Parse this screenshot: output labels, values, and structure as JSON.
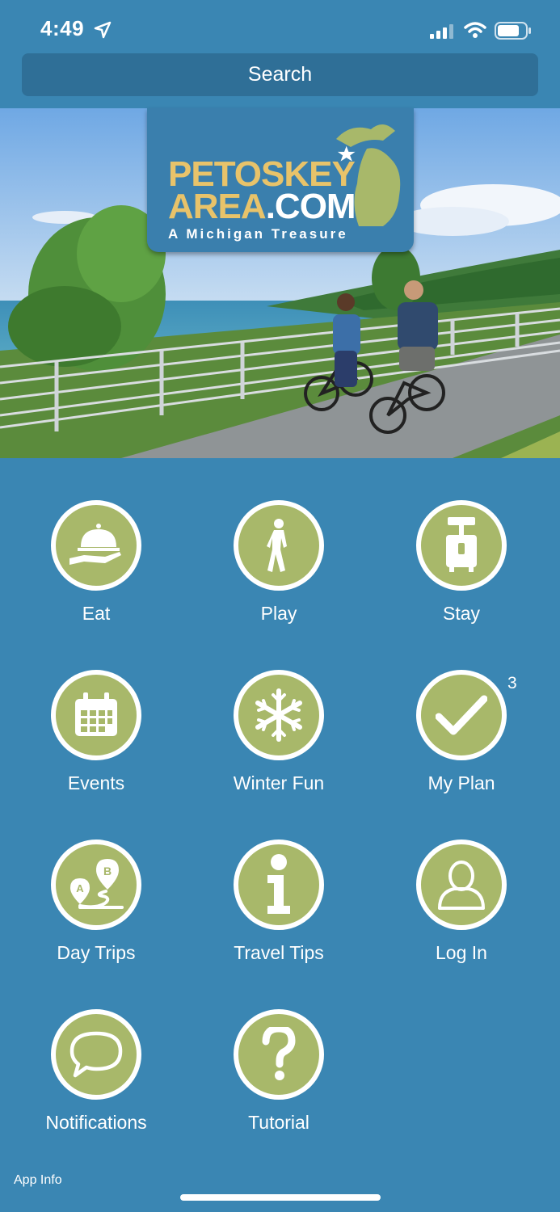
{
  "status": {
    "time": "4:49"
  },
  "search": {
    "label": "Search"
  },
  "logo": {
    "line1": "PETOSKEY",
    "line2_a": "AREA",
    "line2_b": ".COM",
    "tagline": "A Michigan Treasure"
  },
  "menu": {
    "items": [
      {
        "label": "Eat",
        "icon": "service-bell-icon"
      },
      {
        "label": "Play",
        "icon": "walking-person-icon"
      },
      {
        "label": "Stay",
        "icon": "luggage-icon"
      },
      {
        "label": "Events",
        "icon": "calendar-icon"
      },
      {
        "label": "Winter Fun",
        "icon": "snowflake-icon"
      },
      {
        "label": "My Plan",
        "icon": "checkmark-icon",
        "badge": "3"
      },
      {
        "label": "Day Trips",
        "icon": "route-pins-icon"
      },
      {
        "label": "Travel Tips",
        "icon": "info-icon"
      },
      {
        "label": "Log In",
        "icon": "user-icon"
      },
      {
        "label": "Notifications",
        "icon": "speech-bubble-icon"
      },
      {
        "label": "Tutorial",
        "icon": "question-icon"
      }
    ]
  },
  "footer": {
    "app_info": "App Info"
  },
  "colors": {
    "background": "#3a86b3",
    "icon_fill": "#a8b86a",
    "search_bg": "#2f6f97"
  }
}
